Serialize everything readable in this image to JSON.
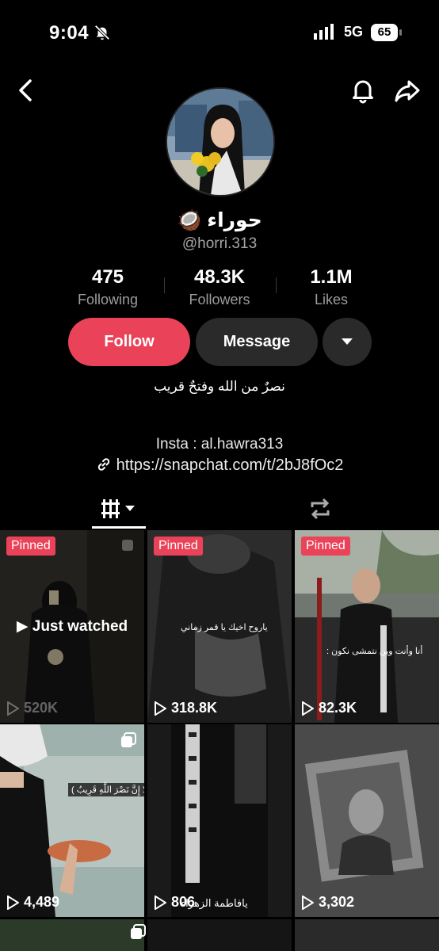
{
  "status_bar": {
    "time": "9:04",
    "network": "5G",
    "battery": "65"
  },
  "profile": {
    "display_name": "حوراء 🥥",
    "username": "@horri.313",
    "stats": [
      {
        "value": "475",
        "label": "Following"
      },
      {
        "value": "48.3K",
        "label": "Followers"
      },
      {
        "value": "1.1M",
        "label": "Likes"
      }
    ],
    "bio": "نصرٌ من الله وفتحٌ قريب",
    "insta": "Insta : al.hawra313",
    "link": "https://snapchat.com/t/2bJ8fOc2"
  },
  "actions": {
    "follow": "Follow",
    "message": "Message"
  },
  "videos": [
    {
      "pinned": "Pinned",
      "views": "520K",
      "badge": "Just watched",
      "bg": "#3b3a36"
    },
    {
      "pinned": "Pinned",
      "views": "318.8K",
      "caption": "ياروح اخيك يا قمر زماني",
      "bg": "#2b2b2b"
    },
    {
      "pinned": "Pinned",
      "views": "82.3K",
      "caption": "أنا وأنت وين نتمشى نكون :",
      "bg": "#50524c"
    },
    {
      "views": "4,489",
      "caption": "( أَلَا إِنَّ نَصْرَ اللَّهِ قَرِيبٌ )",
      "bg": "#9aa7a4"
    },
    {
      "views": "806",
      "caption": "يافاطمة الزهراء",
      "bg": "#1c1c1c"
    },
    {
      "views": "3,302",
      "bg": "#484848"
    }
  ]
}
